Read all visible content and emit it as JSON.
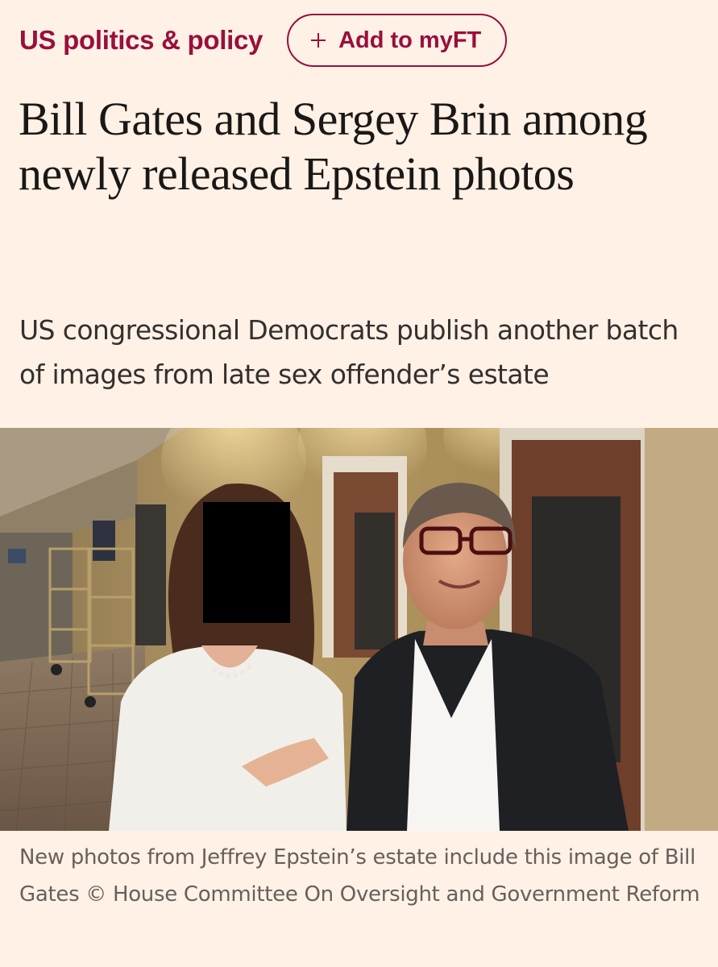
{
  "header": {
    "section": "US politics & policy",
    "myft_label": "Add to myFT",
    "myft_icon": "plus-icon"
  },
  "article": {
    "headline": "Bill Gates and Sergey Brin among newly released Epstein photos",
    "standfirst": "US congressional Democrats publish another batch of images from late sex offender’s estate",
    "caption": "New photos from Jeffrey Epstein’s estate include this image of Bill Gates © House Committee On Oversight and Government Reform"
  },
  "colors": {
    "background": "#fff1e5",
    "accent": "#990f3d",
    "headline_text": "#1a1817",
    "caption_text": "#66605c"
  }
}
